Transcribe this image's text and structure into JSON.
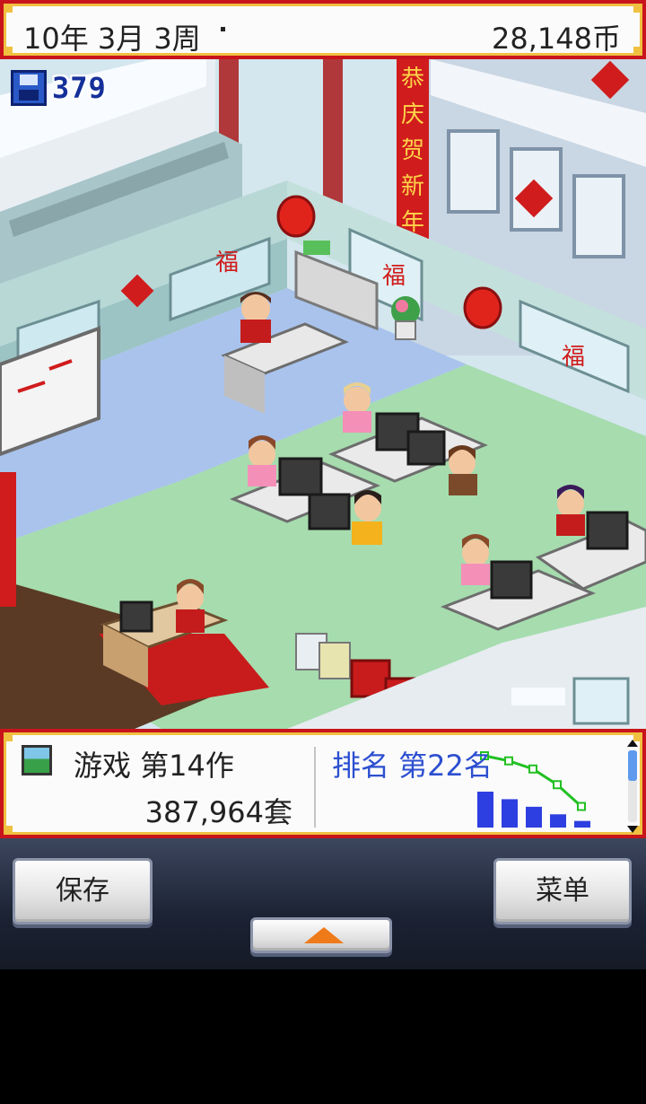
{
  "status": {
    "date": "10年 3月 3周",
    "money": "28,148币"
  },
  "save": {
    "count": "379",
    "icon": "floppy-disk-icon"
  },
  "decor": {
    "banner_text": [
      "恭",
      "庆",
      "贺",
      "新",
      "年"
    ],
    "lucky_char": "福"
  },
  "info_panel": {
    "game_label": "游戏 第14作",
    "sales": "387,964套",
    "rank_label": "排名 第22名",
    "rank_history": [
      8,
      7,
      6,
      4,
      2
    ],
    "sales_history": [
      38,
      30,
      22,
      14,
      7
    ],
    "colors": {
      "rank_line": "#22c022",
      "sales_bars": "#2d3fe0",
      "rank_text": "#2c4fd0"
    }
  },
  "buttons": {
    "save_label": "保存",
    "menu_label": "菜单",
    "expand_icon": "arrow-up-icon"
  },
  "colors": {
    "frame_red": "#c8141c",
    "frame_gold": "#f0c040",
    "orange_arrow": "#ef7a1a"
  }
}
